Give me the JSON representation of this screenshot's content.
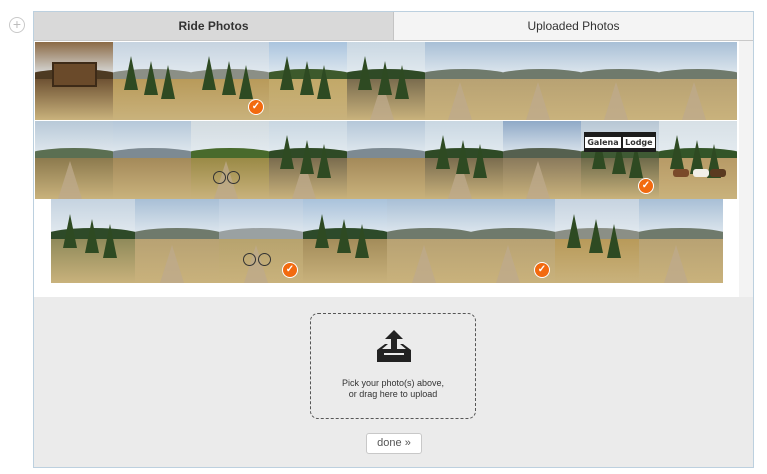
{
  "tabs": [
    {
      "label": "Ride Photos",
      "active": true
    },
    {
      "label": "Uploaded Photos",
      "active": false
    }
  ],
  "add_icon": "plus-circle-icon",
  "check_icon": "checkmark-icon",
  "accent_color": "#f26a0f",
  "photos": [
    {
      "scene": "trail-sign",
      "selected": false
    },
    {
      "scene": "meadow-trees",
      "selected": false
    },
    {
      "scene": "meadow-trees",
      "selected": true
    },
    {
      "scene": "forest-hill",
      "selected": false
    },
    {
      "scene": "forest-road",
      "selected": false
    },
    {
      "scene": "valley-road",
      "selected": false
    },
    {
      "scene": "valley-road",
      "selected": false
    },
    {
      "scene": "valley-road",
      "selected": false
    },
    {
      "scene": "valley-road",
      "selected": false
    },
    {
      "scene": "river-valley",
      "selected": false
    },
    {
      "scene": "mountain-meadow",
      "selected": false
    },
    {
      "scene": "bike-creek",
      "selected": false
    },
    {
      "scene": "forest-road",
      "selected": false
    },
    {
      "scene": "mountain-meadow",
      "selected": false
    },
    {
      "scene": "forest-road",
      "selected": false
    },
    {
      "scene": "mountain-road",
      "selected": false
    },
    {
      "scene": "lodge-sign",
      "selected": true,
      "sign_words": [
        "Galena",
        "Lodge"
      ]
    },
    {
      "scene": "horses-trees",
      "selected": false
    },
    {
      "scene": "forest-meadow",
      "selected": false
    },
    {
      "scene": "valley-road",
      "selected": false
    },
    {
      "scene": "mountain-bike",
      "selected": true
    },
    {
      "scene": "mountain-trees",
      "selected": false
    },
    {
      "scene": "valley-road",
      "selected": false
    },
    {
      "scene": "valley-road",
      "selected": true
    },
    {
      "scene": "meadow-trees",
      "selected": false
    },
    {
      "scene": "valley-road",
      "selected": false
    }
  ],
  "dropzone": {
    "icon": "upload-tray-icon",
    "line1": "Pick your photo(s) above,",
    "line2": "or drag here to upload"
  },
  "done_label": "done »"
}
